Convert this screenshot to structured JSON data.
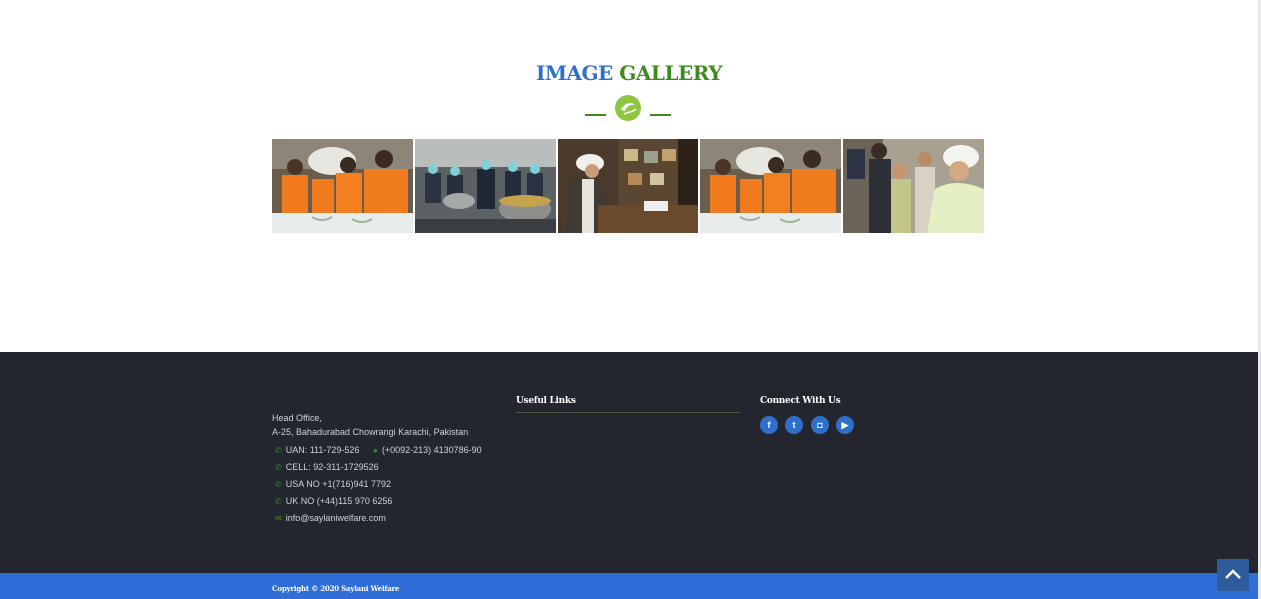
{
  "gallery": {
    "title_part1": "IMAGE",
    "title_part2": "GALLERY",
    "images": [
      {
        "alt": "Volunteers carrying flour sacks"
      },
      {
        "alt": "Kitchen staff cooking in large pots"
      },
      {
        "alt": "Man in turban at desk"
      },
      {
        "alt": "Volunteers carrying flour sacks"
      },
      {
        "alt": "Man in turban with children"
      }
    ]
  },
  "footer": {
    "address_line1": "Head Office,",
    "address_line2": "A-25, Bahadurabad Chowrangi Karachi, Pakistan",
    "uan": "UAN: 111-729-526",
    "fax": "(+0092-213) 4130786-90",
    "cell": "CELL: 92-311-1729526",
    "usa": "USA NO +1(716)941 7792",
    "uk": "UK NO (+44)115 970 6256",
    "email": "info@saylaniwelfare.com",
    "useful_links_title": "Useful Links",
    "connect_title": "Connect With Us",
    "social": [
      {
        "icon": "facebook-icon",
        "glyph": "f"
      },
      {
        "icon": "twitter-icon",
        "glyph": "t"
      },
      {
        "icon": "instagram-icon",
        "glyph": "◘"
      },
      {
        "icon": "youtube-icon",
        "glyph": "▶"
      }
    ]
  },
  "copyright": "Copyright © 2020 Saylani Welfare",
  "colors": {
    "accent_blue": "#2f6ec9",
    "accent_green": "#3f8a1e",
    "footer_bg": "#23262f",
    "copyright_bar": "#2f6ed9"
  }
}
